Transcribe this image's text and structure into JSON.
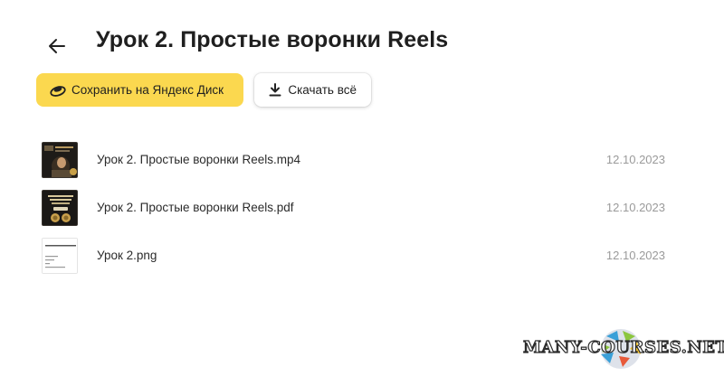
{
  "header": {
    "title": "Урок 2. Простые воронки Reels",
    "back_icon": "arrow-left-icon"
  },
  "actions": {
    "save_label": "Сохранить на Яндекс Диск",
    "save_icon": "yandex-disk-icon",
    "download_label": "Скачать всё",
    "download_icon": "download-icon"
  },
  "files": [
    {
      "name": "Урок 2. Простые воронки Reels.mp4",
      "date": "12.10.2023"
    },
    {
      "name": "Урок 2. Простые воронки Reels.pdf",
      "date": "12.10.2023"
    },
    {
      "name": "Урок 2.png",
      "date": "12.10.2023"
    }
  ],
  "watermark": {
    "text": "MANY-COURSES.NET"
  },
  "colors": {
    "accent": "#fbd84f",
    "text": "#1f1f1f",
    "date": "#9a9a9a"
  }
}
